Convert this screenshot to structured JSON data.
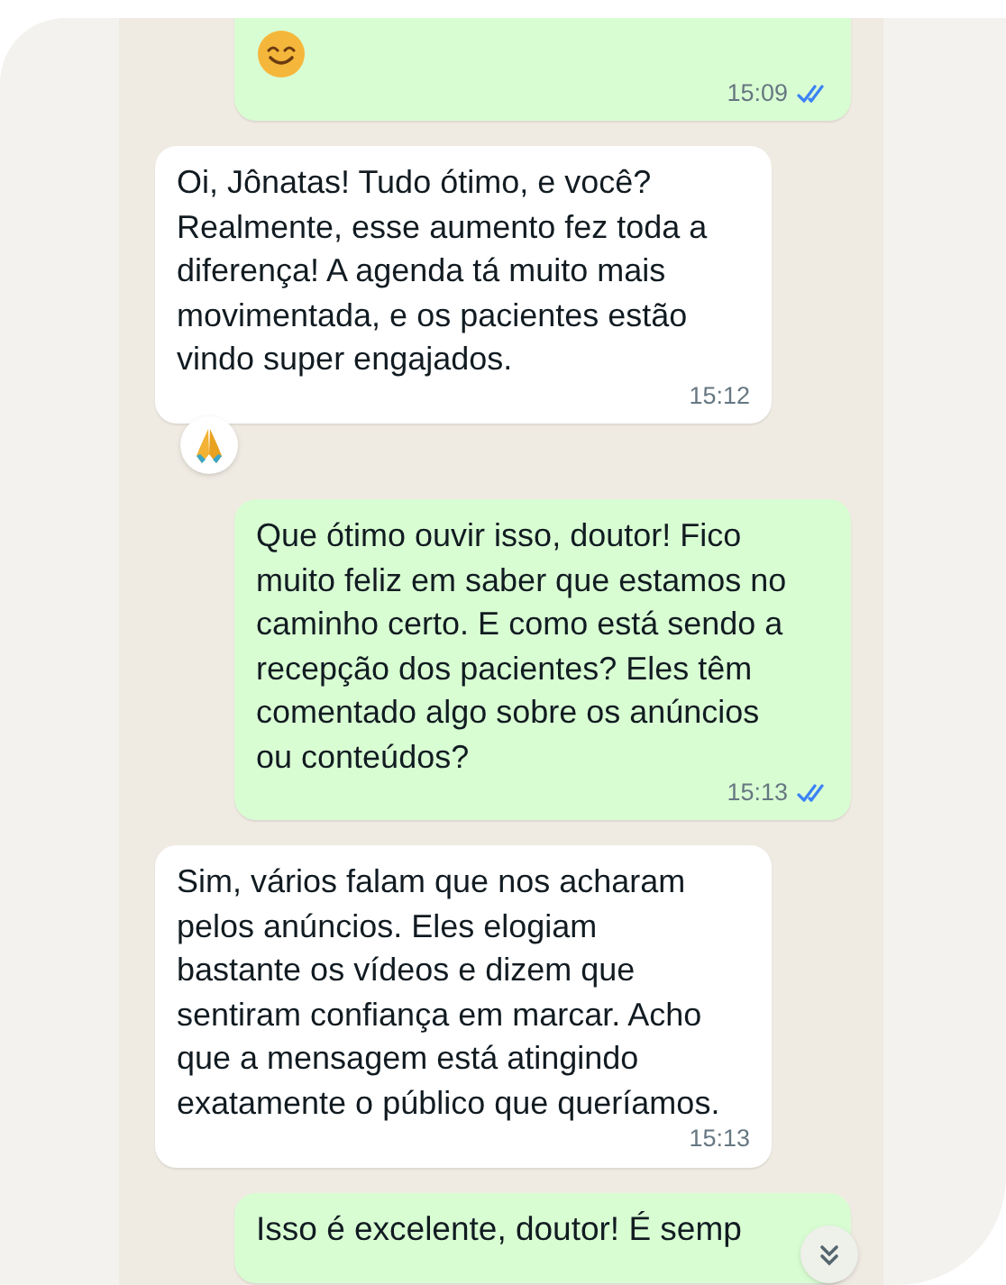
{
  "messages": [
    {
      "kind": "emoji",
      "outgoing": true,
      "time": "15:09",
      "read": true,
      "reacted": false
    },
    {
      "kind": "text",
      "outgoing": false,
      "text": "Oi, Jônatas! Tudo ótimo, e você? Realmente, esse aumento fez toda a diferença! A agenda tá muito mais movimentada, e os pacientes estão vindo super engajados.",
      "time": "15:12",
      "reacted": true
    },
    {
      "kind": "text",
      "outgoing": true,
      "text": "Que ótimo ouvir isso, doutor! Fico muito feliz em saber que estamos no caminho certo. E como está sendo a recepção dos pacientes? Eles têm comentado algo sobre os anúncios ou conteúdos?",
      "time": "15:13",
      "read": true,
      "reacted": false
    },
    {
      "kind": "text",
      "outgoing": false,
      "text": "Sim, vários falam que nos acharam pelos anúncios. Eles elogiam bastante os vídeos e dizem que sentiram confiança em marcar. Acho que a mensagem está atingindo exatamente o público que queríamos.",
      "time": "15:13",
      "reacted": false
    },
    {
      "kind": "partial",
      "outgoing": true,
      "text": "Isso é excelente, doutor! É semp"
    }
  ]
}
